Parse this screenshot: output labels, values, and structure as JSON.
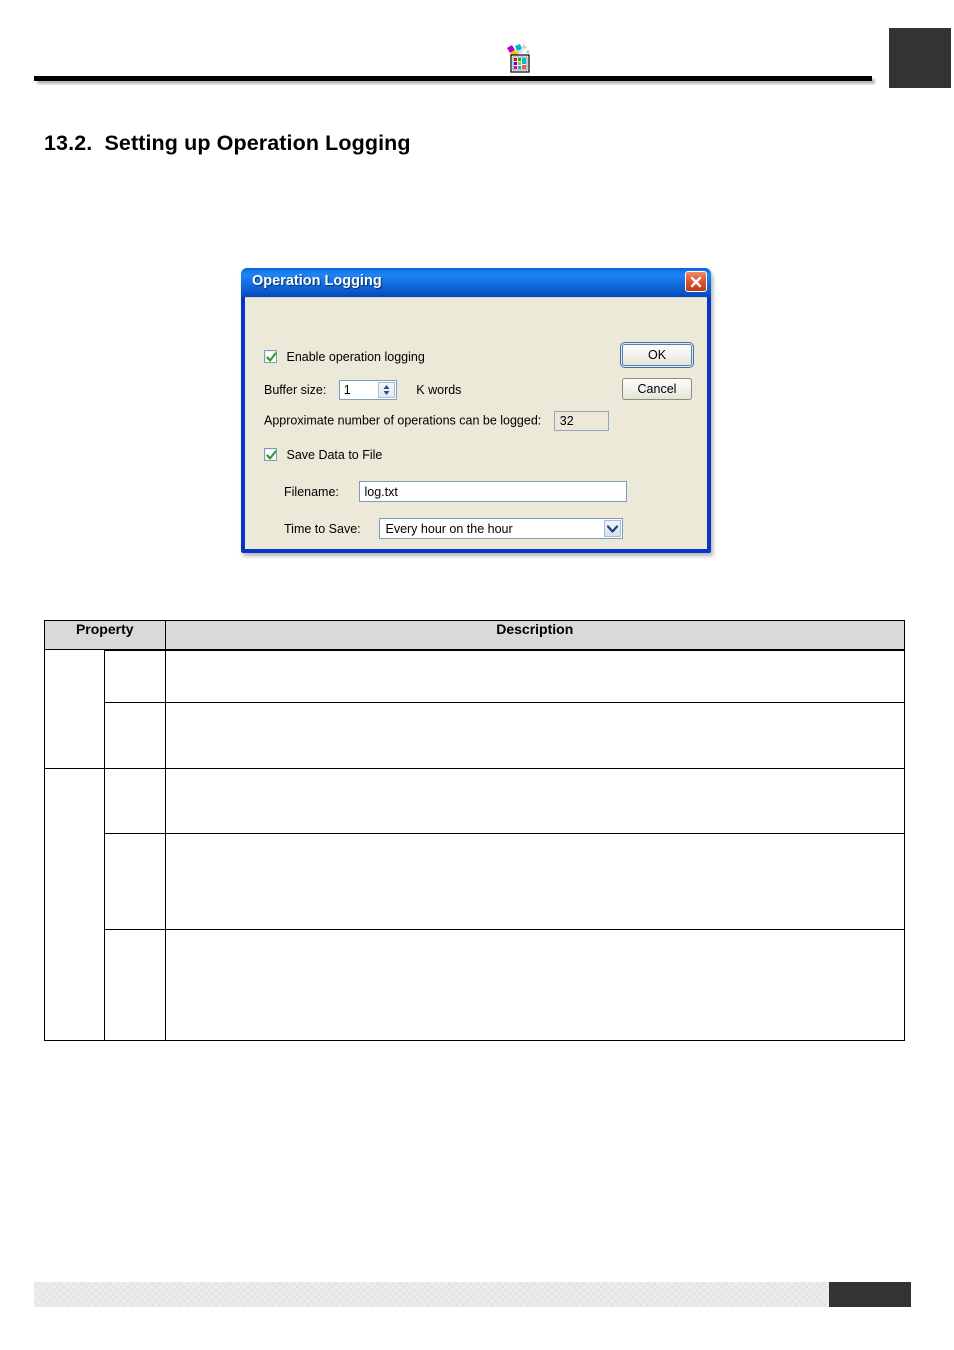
{
  "page": {
    "header": {
      "logo_icon": "application-palette-icon",
      "rule": "horizontal-rule",
      "corner_tab": ""
    },
    "section": {
      "number": "13.2.",
      "title": "Setting up Operation Logging",
      "full_heading": "13.2.  Setting up Operation Logging"
    },
    "footer": {
      "bar": "",
      "corner_tab": ""
    }
  },
  "dialog": {
    "title": "Operation Logging",
    "close_icon": "close-icon",
    "colors": {
      "titlebar": "#1272e8",
      "body": "#ece9d8",
      "frame": "#0a36c8",
      "close_button": "#c33a18",
      "check_mark": "#2f9e2f"
    },
    "enable_logging": {
      "label": "Enable operation logging",
      "checked": true
    },
    "buffer_size": {
      "label": "Buffer size:",
      "value": "1",
      "units": "K words",
      "spinner_icon": "spinner-up-down-icon"
    },
    "approximate_operations": {
      "label": "Approximate number of operations can be logged:",
      "value": "32"
    },
    "save_data_to_file": {
      "label": "Save Data to File",
      "checked": true
    },
    "filename": {
      "label": "Filename:",
      "value": "log.txt",
      "placeholder": ""
    },
    "time_to_save": {
      "label": "Time to Save:",
      "value": "Every hour on the hour",
      "arrow_icon": "chevron-down-icon"
    },
    "buttons": {
      "ok": "OK",
      "cancel": "Cancel"
    }
  },
  "table": {
    "headers": {
      "property": "Property",
      "description": "Description"
    },
    "groups": [
      {
        "category": "",
        "rows": [
          {
            "property": "",
            "description": ""
          },
          {
            "property": "",
            "description": ""
          },
          {
            "property": "",
            "description": ""
          }
        ]
      },
      {
        "category": "",
        "rows": [
          {
            "property": "",
            "description": ""
          },
          {
            "property": "",
            "description": ""
          },
          {
            "property": "",
            "description": ""
          }
        ]
      }
    ]
  }
}
